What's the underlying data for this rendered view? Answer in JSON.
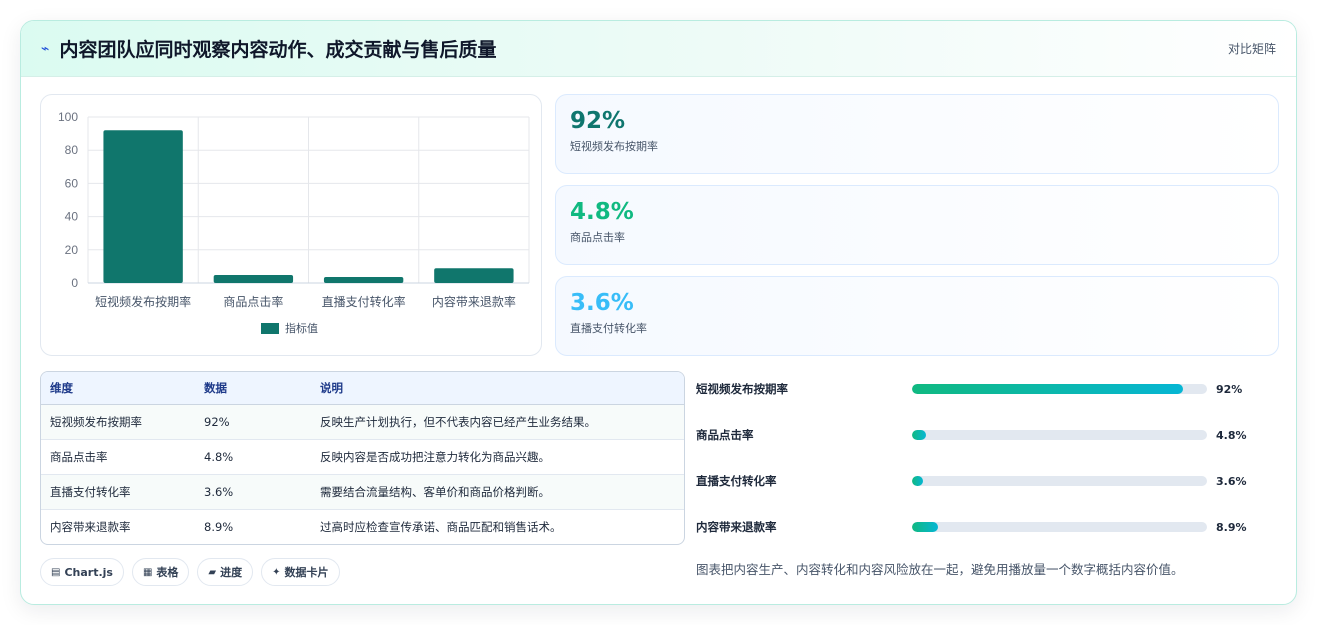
{
  "header": {
    "title": "内容团队应同时观察内容动作、成交贡献与售后质量",
    "tag": "对比矩阵",
    "icon": "bolt-icon"
  },
  "chart_data": {
    "type": "bar",
    "categories": [
      "短视频发布按期率",
      "商品点击率",
      "直播支付转化率",
      "内容带来退款率"
    ],
    "series": [
      {
        "name": "指标值",
        "values": [
          92,
          4.8,
          3.6,
          8.9
        ]
      }
    ],
    "yticks": [
      "0",
      "20",
      "40",
      "60",
      "80",
      "100"
    ],
    "ylim": [
      0,
      100
    ],
    "grid": true,
    "legend": "bottom",
    "color": "#10766c"
  },
  "stats": [
    {
      "value": "92%",
      "label": "短视频发布按期率",
      "color": "#0f766e"
    },
    {
      "value": "4.8%",
      "label": "商品点击率",
      "color": "#10b981"
    },
    {
      "value": "3.6%",
      "label": "直播支付转化率",
      "color": "#38bdf8"
    }
  ],
  "table": {
    "headers": [
      "维度",
      "数据",
      "说明"
    ],
    "rows": [
      [
        "短视频发布按期率",
        "92%",
        "反映生产计划执行，但不代表内容已经产生业务结果。"
      ],
      [
        "商品点击率",
        "4.8%",
        "反映内容是否成功把注意力转化为商品兴趣。"
      ],
      [
        "直播支付转化率",
        "3.6%",
        "需要结合流量结构、客单价和商品价格判断。"
      ],
      [
        "内容带来退款率",
        "8.9%",
        "过高时应检查宣传承诺、商品匹配和销售话术。"
      ]
    ]
  },
  "progress": [
    {
      "label": "短视频发布按期率",
      "value": "92%",
      "percent": 92
    },
    {
      "label": "商品点击率",
      "value": "4.8%",
      "percent": 4.8
    },
    {
      "label": "直播支付转化率",
      "value": "3.6%",
      "percent": 3.6
    },
    {
      "label": "内容带来退款率",
      "value": "8.9%",
      "percent": 8.9
    }
  ],
  "note": "图表把内容生产、内容转化和内容风险放在一起，避免用播放量一个数字概括内容价值。",
  "pills": [
    {
      "icon": "chart-icon",
      "glyph": "▤",
      "label": "Chart.js"
    },
    {
      "icon": "table-icon",
      "glyph": "▦",
      "label": "表格"
    },
    {
      "icon": "folder-icon",
      "glyph": "▰",
      "label": "进度"
    },
    {
      "icon": "sparkle-icon",
      "glyph": "✦",
      "label": "数据卡片"
    }
  ]
}
